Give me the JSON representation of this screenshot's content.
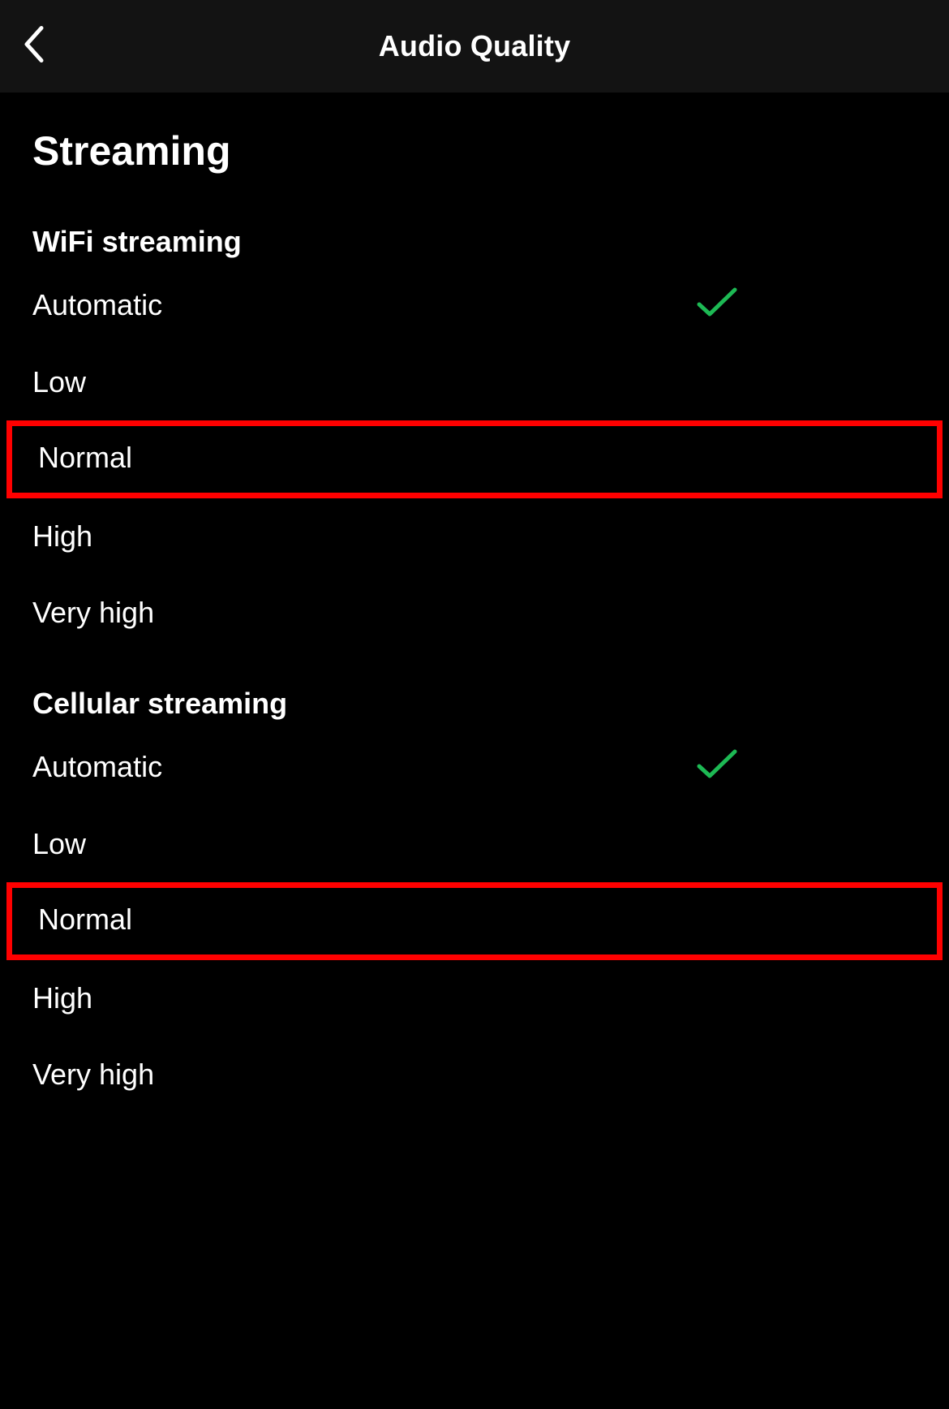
{
  "header": {
    "title": "Audio Quality"
  },
  "section": {
    "title": "Streaming"
  },
  "wifi": {
    "title": "WiFi streaming",
    "options": {
      "automatic": "Automatic",
      "low": "Low",
      "normal": "Normal",
      "high": "High",
      "veryhigh": "Very high"
    },
    "selected": "automatic",
    "highlighted": "normal"
  },
  "cellular": {
    "title": "Cellular streaming",
    "options": {
      "automatic": "Automatic",
      "low": "Low",
      "normal": "Normal",
      "high": "High",
      "veryhigh": "Very high"
    },
    "selected": "automatic",
    "highlighted": "normal"
  },
  "colors": {
    "check": "#1db954",
    "highlight": "#ff0000"
  }
}
